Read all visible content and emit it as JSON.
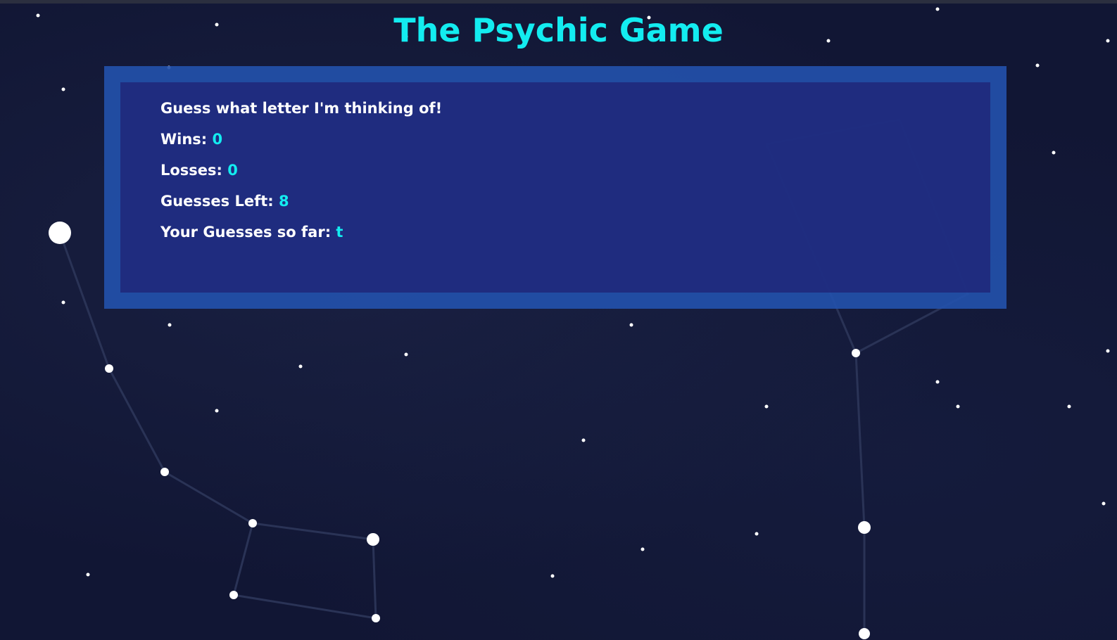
{
  "title": "The Psychic Game",
  "game": {
    "prompt": "Guess what letter I'm thinking of!",
    "wins_label": "Wins:",
    "wins_value": "0",
    "losses_label": "Losses:",
    "losses_value": "0",
    "guesses_left_label": "Guesses Left:",
    "guesses_left_value": "8",
    "your_guesses_label": "Your Guesses so far:",
    "your_guesses_value": "t"
  },
  "colors": {
    "background": "#111634",
    "accent": "#13ecf0",
    "panel_border": "#2350aa",
    "panel_fill": "#1e2678",
    "text": "#ffffff"
  }
}
